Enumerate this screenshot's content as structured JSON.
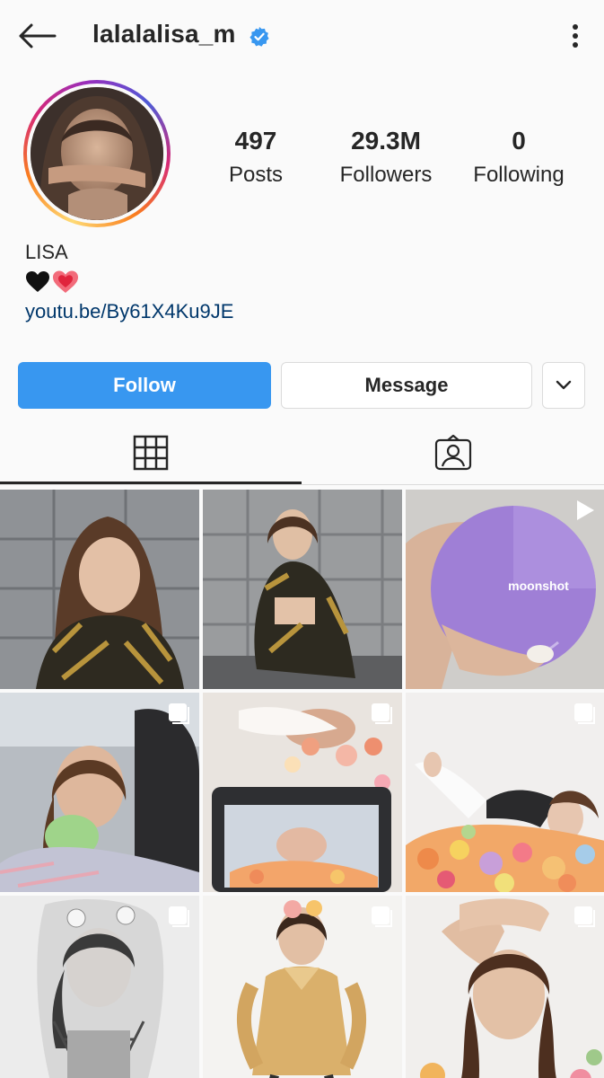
{
  "header": {
    "username": "lalalalisa_m",
    "verified": true
  },
  "profile": {
    "stats": [
      {
        "value": "497",
        "label": "Posts"
      },
      {
        "value": "29.3M",
        "label": "Followers"
      },
      {
        "value": "0",
        "label": "Following"
      }
    ],
    "name": "LISA",
    "bio_emojis": [
      "black-heart",
      "beating-heart"
    ],
    "link": "youtu.be/By61X4Ku9JE"
  },
  "actions": {
    "follow_label": "Follow",
    "message_label": "Message"
  },
  "tabs": [
    {
      "icon": "grid-icon",
      "active": true
    },
    {
      "icon": "tagged-person-icon",
      "active": false
    }
  ],
  "posts": [
    {
      "badge": "none",
      "text": ""
    },
    {
      "badge": "none",
      "text": ""
    },
    {
      "badge": "video",
      "text": "moonshot"
    },
    {
      "badge": "multiple",
      "text": ""
    },
    {
      "badge": "multiple",
      "text": ""
    },
    {
      "badge": "multiple",
      "text": ""
    },
    {
      "badge": "multiple",
      "text": ""
    },
    {
      "badge": "multiple",
      "text": ""
    },
    {
      "badge": "multiple",
      "text": ""
    }
  ],
  "colors": {
    "follow_button": "#3897f0",
    "verified_badge": "#3897f0",
    "link": "#00376b"
  }
}
